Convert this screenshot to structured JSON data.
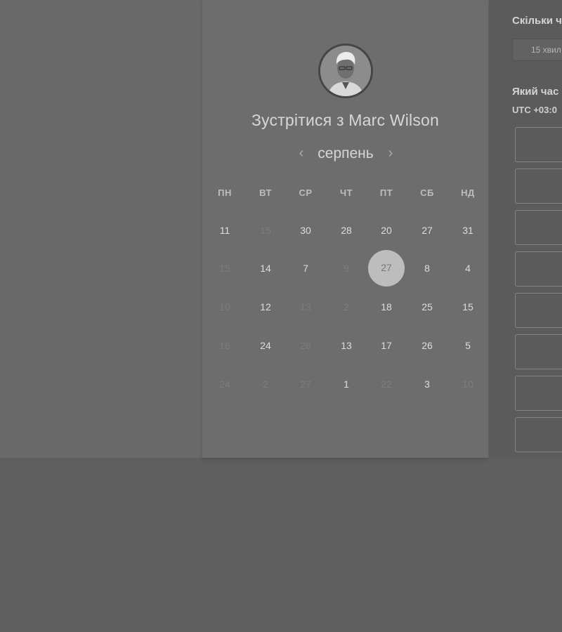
{
  "meeting": {
    "title": "Зустрітися з Marc Wilson",
    "avatar_icon": "person-avatar-icon"
  },
  "calendar": {
    "month": "серпень",
    "prev_icon": "chevron-left-icon",
    "next_icon": "chevron-right-icon",
    "weekdays": [
      "ПН",
      "ВТ",
      "СР",
      "ЧТ",
      "ПТ",
      "СБ",
      "НД"
    ],
    "rows": [
      [
        {
          "d": "11",
          "a": true
        },
        {
          "d": "15",
          "a": false
        },
        {
          "d": "30",
          "a": true
        },
        {
          "d": "28",
          "a": true
        },
        {
          "d": "20",
          "a": true
        },
        {
          "d": "27",
          "a": true
        },
        {
          "d": "31",
          "a": true
        }
      ],
      [
        {
          "d": "15",
          "a": false
        },
        {
          "d": "14",
          "a": true
        },
        {
          "d": "7",
          "a": true
        },
        {
          "d": "9",
          "a": false
        },
        {
          "d": "27",
          "a": true,
          "sel": true
        },
        {
          "d": "8",
          "a": true
        },
        {
          "d": "4",
          "a": true
        }
      ],
      [
        {
          "d": "10",
          "a": false
        },
        {
          "d": "12",
          "a": true
        },
        {
          "d": "13",
          "a": false
        },
        {
          "d": "2",
          "a": false
        },
        {
          "d": "18",
          "a": true
        },
        {
          "d": "25",
          "a": true
        },
        {
          "d": "15",
          "a": true
        }
      ],
      [
        {
          "d": "16",
          "a": false
        },
        {
          "d": "24",
          "a": true
        },
        {
          "d": "28",
          "a": false
        },
        {
          "d": "13",
          "a": true
        },
        {
          "d": "17",
          "a": true
        },
        {
          "d": "26",
          "a": true
        },
        {
          "d": "5",
          "a": true
        }
      ],
      [
        {
          "d": "24",
          "a": false
        },
        {
          "d": "2",
          "a": false
        },
        {
          "d": "27",
          "a": false
        },
        {
          "d": "1",
          "a": true
        },
        {
          "d": "22",
          "a": false
        },
        {
          "d": "3",
          "a": true
        },
        {
          "d": "10",
          "a": false
        }
      ]
    ]
  },
  "booking": {
    "duration_heading": "Скільки ч",
    "duration_value": "15 хвил",
    "time_heading": "Який час",
    "timezone": "UTC +03:0"
  }
}
